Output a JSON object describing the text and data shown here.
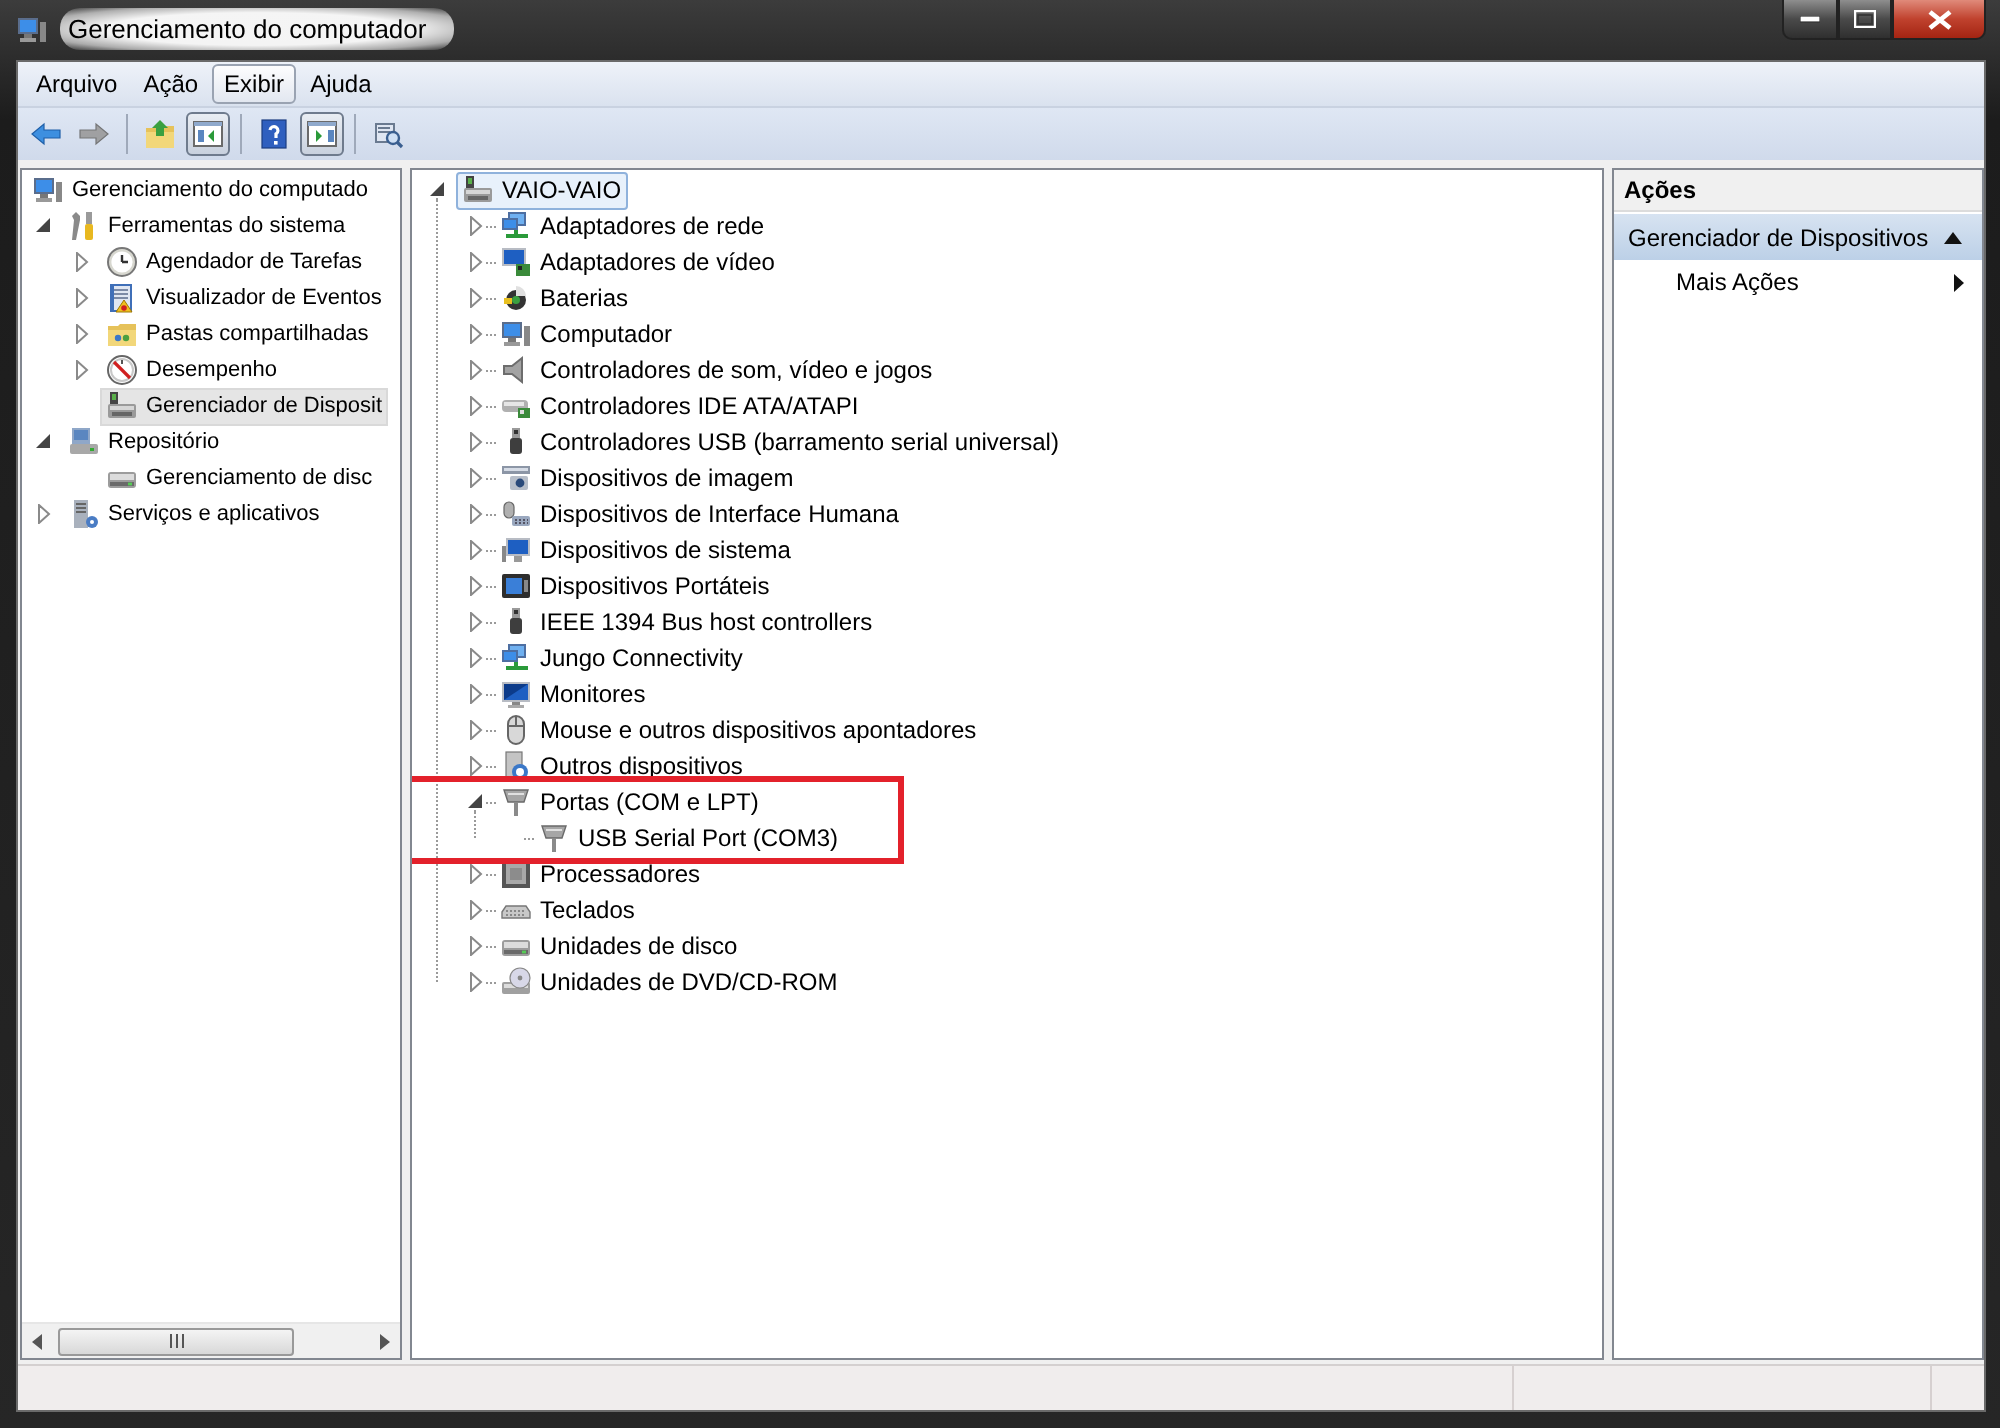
{
  "window": {
    "title": "Gerenciamento do computador"
  },
  "menu": [
    {
      "label": "Arquivo",
      "selected": false
    },
    {
      "label": "Ação",
      "selected": false
    },
    {
      "label": "Exibir",
      "selected": true
    },
    {
      "label": "Ajuda",
      "selected": false
    }
  ],
  "toolbar": [
    {
      "kind": "back",
      "disabled": false,
      "pressed": false
    },
    {
      "kind": "forward",
      "disabled": true,
      "pressed": false
    },
    {
      "kind": "separator"
    },
    {
      "kind": "up",
      "disabled": false,
      "pressed": false
    },
    {
      "kind": "tree-pane",
      "disabled": false,
      "pressed": true
    },
    {
      "kind": "separator"
    },
    {
      "kind": "help",
      "disabled": false,
      "pressed": false
    },
    {
      "kind": "action-pane",
      "disabled": false,
      "pressed": true
    },
    {
      "kind": "separator"
    },
    {
      "kind": "properties",
      "disabled": false,
      "pressed": false
    }
  ],
  "nav_tree": [
    {
      "label": "Gerenciamento do computado",
      "selected": false,
      "children": [
        {
          "label": "Ferramentas do sistema",
          "selected": false,
          "expanded": true,
          "children": [
            {
              "label": "Agendador de Tarefas",
              "selected": false,
              "expanded": false
            },
            {
              "label": "Visualizador de Eventos",
              "selected": false,
              "expanded": false
            },
            {
              "label": "Pastas compartilhadas",
              "selected": false,
              "expanded": false
            },
            {
              "label": "Desempenho",
              "selected": false,
              "expanded": false
            },
            {
              "label": "Gerenciador de Disposit",
              "selected": true
            }
          ]
        },
        {
          "label": "Repositório",
          "selected": false,
          "expanded": true,
          "children": [
            {
              "label": "Gerenciamento de disc",
              "selected": false
            }
          ]
        },
        {
          "label": "Serviços e aplicativos",
          "selected": false,
          "expanded": false
        }
      ]
    }
  ],
  "device_tree": [
    {
      "label": "VAIO-VAIO",
      "selected": true,
      "expanded": true,
      "children": [
        {
          "label": "Adaptadores de rede",
          "selected": false,
          "expanded": false
        },
        {
          "label": "Adaptadores de vídeo",
          "selected": false,
          "expanded": false
        },
        {
          "label": "Baterias",
          "selected": false,
          "expanded": false
        },
        {
          "label": "Computador",
          "selected": false,
          "expanded": false
        },
        {
          "label": "Controladores de som, vídeo e jogos",
          "selected": false,
          "expanded": false
        },
        {
          "label": "Controladores IDE ATA/ATAPI",
          "selected": false,
          "expanded": false
        },
        {
          "label": "Controladores USB (barramento serial universal)",
          "selected": false,
          "expanded": false
        },
        {
          "label": "Dispositivos de imagem",
          "selected": false,
          "expanded": false
        },
        {
          "label": "Dispositivos de Interface Humana",
          "selected": false,
          "expanded": false
        },
        {
          "label": "Dispositivos de sistema",
          "selected": false,
          "expanded": false
        },
        {
          "label": "Dispositivos Portáteis",
          "selected": false,
          "expanded": false
        },
        {
          "label": "IEEE 1394 Bus host controllers",
          "selected": false,
          "expanded": false
        },
        {
          "label": "Jungo Connectivity",
          "selected": false,
          "expanded": false
        },
        {
          "label": "Monitores",
          "selected": false,
          "expanded": false
        },
        {
          "label": "Mouse e outros dispositivos apontadores",
          "selected": false,
          "expanded": false
        },
        {
          "label": "Outros dispositivos",
          "selected": false,
          "expanded": false
        },
        {
          "label": "Portas (COM e LPT)",
          "selected": false,
          "expanded": true,
          "highlighted": true,
          "children": [
            {
              "label": "USB Serial Port (COM3)",
              "selected": false
            }
          ]
        },
        {
          "label": "Processadores",
          "selected": false,
          "expanded": false
        },
        {
          "label": "Teclados",
          "selected": false,
          "expanded": false
        },
        {
          "label": "Unidades de disco",
          "selected": false,
          "expanded": false
        },
        {
          "label": "Unidades de DVD/CD-ROM",
          "selected": false,
          "expanded": false
        }
      ]
    }
  ],
  "actions_pane": {
    "title": "Ações",
    "sections": [
      {
        "label": "Gerenciador de Dispositivos",
        "expanded": true,
        "items": [
          {
            "label": "Mais Ações"
          }
        ]
      }
    ]
  }
}
